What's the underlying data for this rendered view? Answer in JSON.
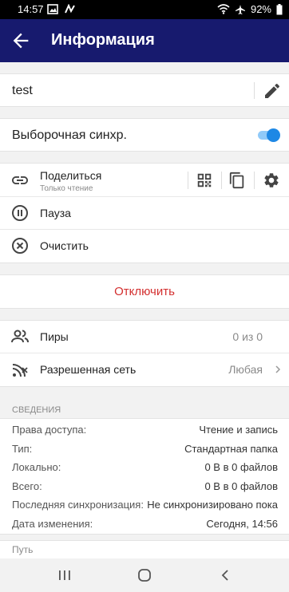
{
  "status": {
    "time": "14:57",
    "battery": "92%",
    "left_icons": [
      "image-icon",
      "signal-tool-icon"
    ],
    "right_icons": [
      "wifi-icon",
      "airplane-icon",
      "battery-icon"
    ]
  },
  "appbar": {
    "title": "Информация",
    "color": "#171a6e"
  },
  "folder": {
    "name": "test"
  },
  "selective": {
    "label": "Выборочная синхр.",
    "enabled": true,
    "accent": "#1e88e5"
  },
  "share": {
    "label": "Поделиться",
    "sub": "Только чтение"
  },
  "actions": {
    "pause": "Пауза",
    "clear": "Очистить",
    "disconnect": "Отключить",
    "disconnect_color": "#d32f2f"
  },
  "peers": {
    "label": "Пиры",
    "value": "0 из 0"
  },
  "network": {
    "label": "Разрешенная сеть",
    "value": "Любая"
  },
  "details": {
    "header": "СВЕДЕНИЯ",
    "rows": [
      {
        "k": "Права доступа:",
        "v": "Чтение и запись"
      },
      {
        "k": "Тип:",
        "v": "Стандартная папка"
      },
      {
        "k": "Локально:",
        "v": "0 В в 0 файлов"
      },
      {
        "k": "Всего:",
        "v": "0 В в 0 файлов"
      },
      {
        "k": "Последняя синхронизация:",
        "v": "Не синхронизировано пока"
      },
      {
        "k": "Дата изменения:",
        "v": "Сегодня, 14:56"
      }
    ]
  },
  "path": {
    "label": "Путь"
  }
}
